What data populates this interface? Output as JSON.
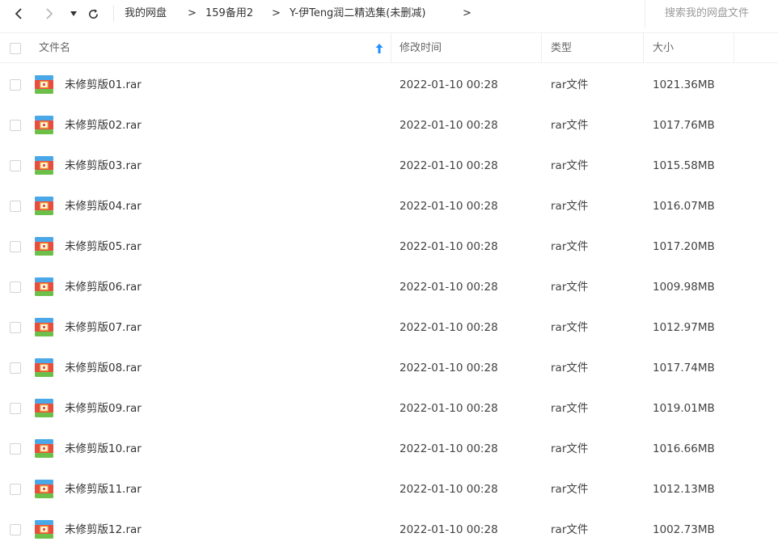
{
  "toolbar": {
    "back_glyph": "‹",
    "forward_glyph": "›",
    "dropdown_glyph": "▾",
    "refresh_glyph": "⟳",
    "breadcrumbs": [
      "我的网盘",
      "159备用2",
      "Y-伊Teng润二精选集(未删减)"
    ],
    "crumb_separator": ">",
    "search_placeholder": "搜索我的网盘文件"
  },
  "table": {
    "columns": {
      "name": "文件名",
      "modified": "修改时间",
      "type": "类型",
      "size": "大小"
    },
    "sort_indicator": "↑",
    "rows": [
      {
        "name": "未修剪版01.rar",
        "modified": "2022-01-10 00:28",
        "type": "rar文件",
        "size": "1021.36MB"
      },
      {
        "name": "未修剪版02.rar",
        "modified": "2022-01-10 00:28",
        "type": "rar文件",
        "size": "1017.76MB"
      },
      {
        "name": "未修剪版03.rar",
        "modified": "2022-01-10 00:28",
        "type": "rar文件",
        "size": "1015.58MB"
      },
      {
        "name": "未修剪版04.rar",
        "modified": "2022-01-10 00:28",
        "type": "rar文件",
        "size": "1016.07MB"
      },
      {
        "name": "未修剪版05.rar",
        "modified": "2022-01-10 00:28",
        "type": "rar文件",
        "size": "1017.20MB"
      },
      {
        "name": "未修剪版06.rar",
        "modified": "2022-01-10 00:28",
        "type": "rar文件",
        "size": "1009.98MB"
      },
      {
        "name": "未修剪版07.rar",
        "modified": "2022-01-10 00:28",
        "type": "rar文件",
        "size": "1012.97MB"
      },
      {
        "name": "未修剪版08.rar",
        "modified": "2022-01-10 00:28",
        "type": "rar文件",
        "size": "1017.74MB"
      },
      {
        "name": "未修剪版09.rar",
        "modified": "2022-01-10 00:28",
        "type": "rar文件",
        "size": "1019.01MB"
      },
      {
        "name": "未修剪版10.rar",
        "modified": "2022-01-10 00:28",
        "type": "rar文件",
        "size": "1016.66MB"
      },
      {
        "name": "未修剪版11.rar",
        "modified": "2022-01-10 00:28",
        "type": "rar文件",
        "size": "1012.13MB"
      },
      {
        "name": "未修剪版12.rar",
        "modified": "2022-01-10 00:28",
        "type": "rar文件",
        "size": "1002.73MB"
      }
    ]
  },
  "icons": {
    "file": "archive-rar-icon",
    "sort": "sort-ascending-icon"
  },
  "colors": {
    "sort_arrow": "#1e90ff",
    "archive_red": "#e84e40",
    "archive_blue": "#4aa8e8",
    "archive_green": "#6cc04a",
    "archive_yellow": "#f6c342"
  }
}
